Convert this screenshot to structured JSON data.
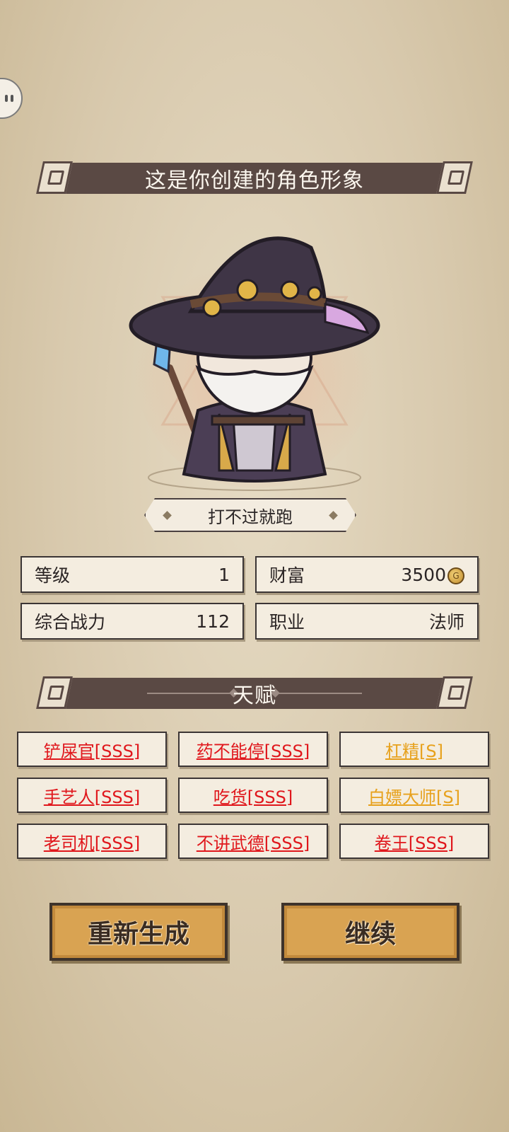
{
  "header": {
    "title": "这是你创建的角色形象"
  },
  "character": {
    "name": "打不过就跑"
  },
  "stats": {
    "level_label": "等级",
    "level_value": "1",
    "wealth_label": "财富",
    "wealth_value": "3500",
    "power_label": "综合战力",
    "power_value": "112",
    "job_label": "职业",
    "job_value": "法师"
  },
  "talents": {
    "title": "天赋",
    "items": [
      {
        "label": "铲屎官[SSS]",
        "color": "#e0171c"
      },
      {
        "label": "药不能停[SSS]",
        "color": "#e0171c"
      },
      {
        "label": "杠精[S]",
        "color": "#e7a11c"
      },
      {
        "label": "手艺人[SSS]",
        "color": "#e0171c"
      },
      {
        "label": "吃货[SSS]",
        "color": "#e0171c"
      },
      {
        "label": "白嫖大师[S]",
        "color": "#e7a11c"
      },
      {
        "label": "老司机[SSS]",
        "color": "#e0171c"
      },
      {
        "label": "不讲武德[SSS]",
        "color": "#e0171c"
      },
      {
        "label": "卷王[SSS]",
        "color": "#e0171c"
      }
    ]
  },
  "actions": {
    "regenerate": "重新生成",
    "continue": "继续"
  }
}
